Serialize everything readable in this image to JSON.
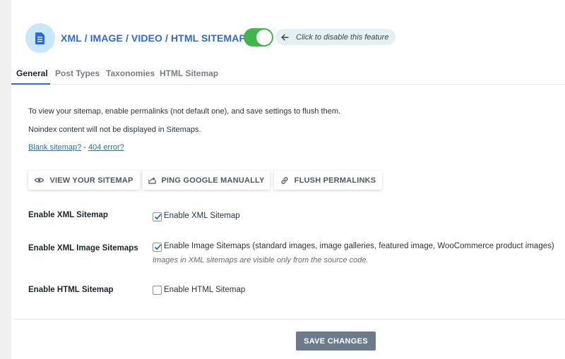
{
  "header": {
    "title": "XML / IMAGE / VIDEO / HTML SITEMAP",
    "toggle_state": "on",
    "toggle_hint": "Click to disable this feature",
    "logo_icon": "document-icon",
    "accent_color": "#2b6bd6",
    "toggle_color": "#3fb74b"
  },
  "tabs": [
    {
      "label": "General",
      "active": true
    },
    {
      "label": "Post Types",
      "active": false
    },
    {
      "label": "Taxonomies",
      "active": false
    },
    {
      "label": "HTML Sitemap",
      "active": false
    }
  ],
  "info": {
    "line1": "To view your sitemap, enable permalinks (not default one), and save settings to flush them.",
    "line2": "Noindex content will not be displayed in Sitemaps.",
    "link_blank": "Blank sitemap?",
    "link_separator": " - ",
    "link_404": "404 error?"
  },
  "actions": {
    "view_sitemap": "VIEW YOUR SITEMAP",
    "ping_google": "PING GOOGLE MANUALLY",
    "flush_permalinks": "FLUSH PERMALINKS"
  },
  "settings": [
    {
      "label": "Enable XML Sitemap",
      "checkbox_label": "Enable XML Sitemap",
      "checked": true
    },
    {
      "label": "Enable XML Image Sitemaps",
      "checkbox_label": "Enable Image Sitemaps (standard images, image galleries, featured image, WooCommerce product images)",
      "checked": true,
      "description": "Images in XML sitemaps are visible only from the source code."
    },
    {
      "label": "Enable HTML Sitemap",
      "checkbox_label": "Enable HTML Sitemap",
      "checked": false
    }
  ],
  "footer": {
    "save_label": "SAVE CHANGES"
  }
}
